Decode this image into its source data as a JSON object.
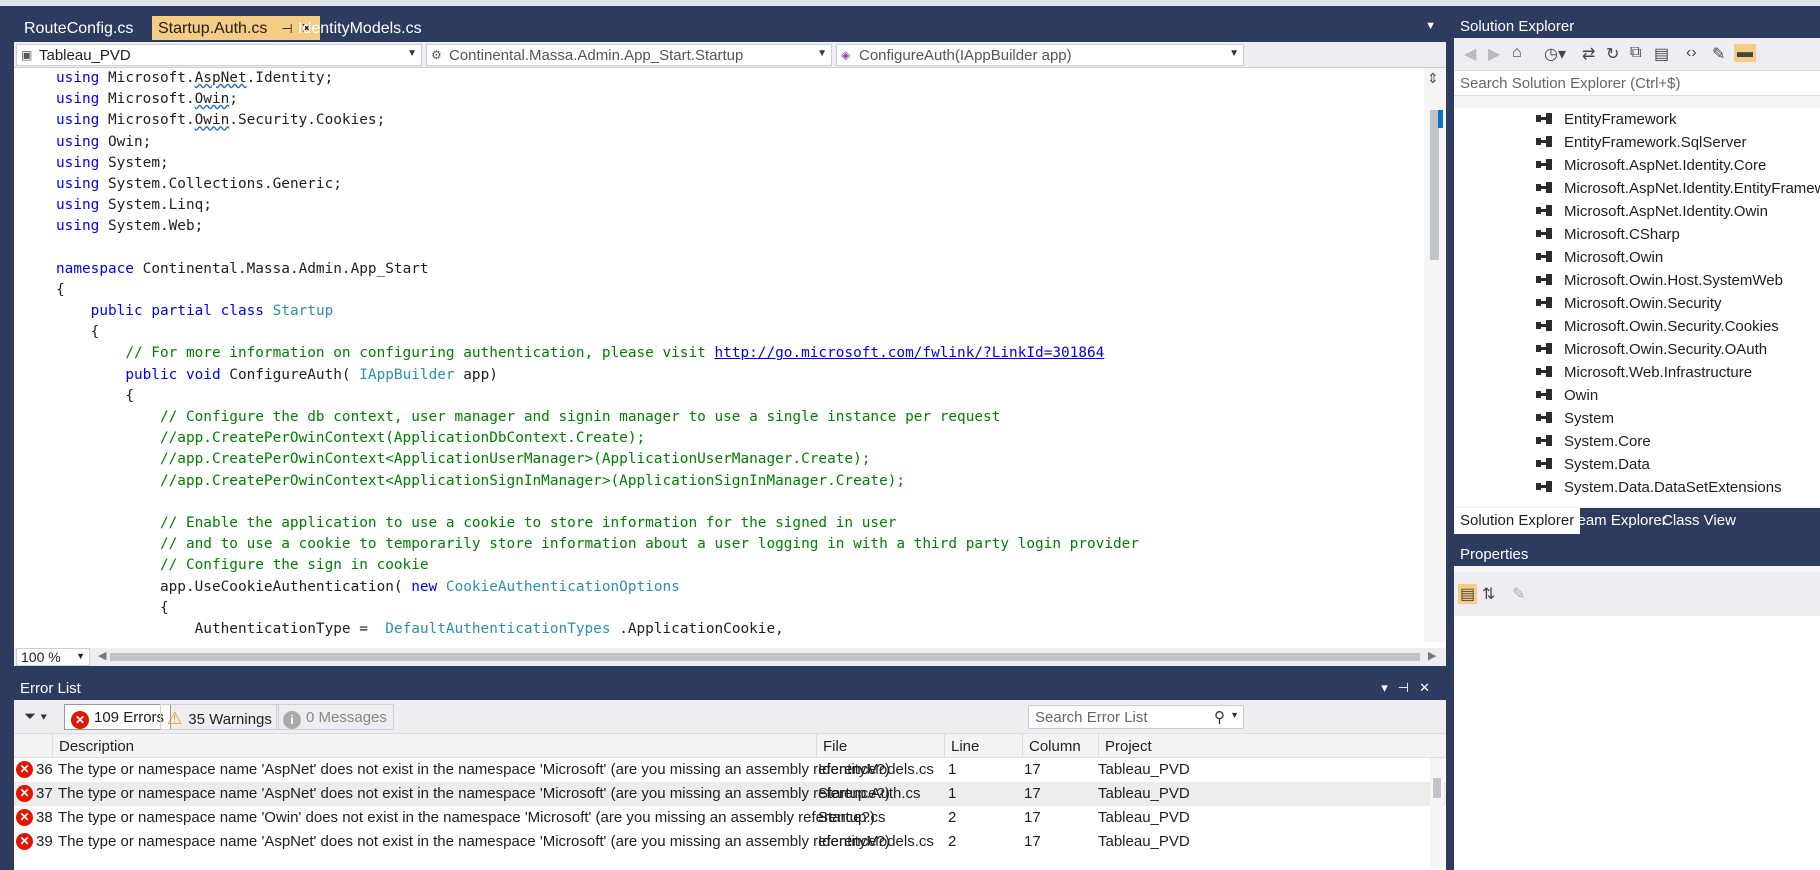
{
  "tabs": [
    {
      "label": "RouteConfig.cs",
      "active": false
    },
    {
      "label": "Startup.Auth.cs",
      "active": true
    },
    {
      "label": "IdentityModels.cs",
      "active": false
    }
  ],
  "navbar": {
    "project": "Tableau_PVD",
    "type": "Continental.Massa.Admin.App_Start.Startup",
    "member": "ConfigureAuth(IAppBuilder app)"
  },
  "code_lines": [
    {
      "indent": "",
      "parts": [
        [
          "kw",
          "using"
        ],
        [
          "",
          "Microsoft.AspNet.Identity;"
        ]
      ]
    },
    {
      "indent": "",
      "parts": [
        [
          "kw",
          "using"
        ],
        [
          "",
          "Microsoft.Owin;"
        ]
      ]
    },
    {
      "indent": "",
      "parts": [
        [
          "kw",
          "using"
        ],
        [
          "",
          "Microsoft.Owin.Security.Cookies;"
        ]
      ]
    },
    {
      "indent": "",
      "parts": [
        [
          "kw",
          "using"
        ],
        [
          "",
          "Owin;"
        ]
      ]
    },
    {
      "indent": "",
      "parts": [
        [
          "kw",
          "using"
        ],
        [
          "",
          "System;"
        ]
      ]
    },
    {
      "indent": "",
      "parts": [
        [
          "kw",
          "using"
        ],
        [
          "",
          "System.Collections.Generic;"
        ]
      ]
    },
    {
      "indent": "",
      "parts": [
        [
          "kw",
          "using"
        ],
        [
          "",
          "System.Linq;"
        ]
      ]
    },
    {
      "indent": "",
      "parts": [
        [
          "kw",
          "using"
        ],
        [
          "",
          "System.Web;"
        ]
      ]
    },
    {
      "indent": "",
      "parts": []
    },
    {
      "indent": "",
      "parts": [
        [
          "kw",
          "namespace"
        ],
        [
          "",
          "Continental.Massa.Admin.App_Start"
        ]
      ]
    },
    {
      "indent": "",
      "parts": [
        [
          "",
          "{"
        ]
      ]
    },
    {
      "indent": "    ",
      "parts": [
        [
          "kw",
          "public"
        ],
        [
          "kw",
          "partial"
        ],
        [
          "kw",
          "class"
        ],
        [
          "ty",
          "Startup"
        ]
      ]
    },
    {
      "indent": "    ",
      "parts": [
        [
          "",
          "{"
        ]
      ]
    },
    {
      "indent": "        ",
      "parts": [
        [
          "cm",
          "// For more information on configuring authentication, please visit"
        ],
        [
          "lk",
          "http://go.microsoft.com/fwlink/?LinkId=301864"
        ]
      ]
    },
    {
      "indent": "        ",
      "parts": [
        [
          "kw",
          "public"
        ],
        [
          "kw",
          "void"
        ],
        [
          "",
          "ConfigureAuth("
        ],
        [
          "ty",
          "IAppBuilder"
        ],
        [
          "",
          "app)"
        ]
      ]
    },
    {
      "indent": "        ",
      "parts": [
        [
          "",
          "{"
        ]
      ]
    },
    {
      "indent": "            ",
      "parts": [
        [
          "cm",
          "// Configure the db context, user manager and signin manager to use a single instance per request"
        ]
      ]
    },
    {
      "indent": "            ",
      "parts": [
        [
          "cm",
          "//app.CreatePerOwinContext(ApplicationDbContext.Create);"
        ]
      ]
    },
    {
      "indent": "            ",
      "parts": [
        [
          "cm",
          "//app.CreatePerOwinContext<ApplicationUserManager>(ApplicationUserManager.Create);"
        ]
      ]
    },
    {
      "indent": "            ",
      "parts": [
        [
          "cm",
          "//app.CreatePerOwinContext<ApplicationSignInManager>(ApplicationSignInManager.Create);"
        ]
      ]
    },
    {
      "indent": "",
      "parts": []
    },
    {
      "indent": "            ",
      "parts": [
        [
          "cm",
          "// Enable the application to use a cookie to store information for the signed in user"
        ]
      ]
    },
    {
      "indent": "            ",
      "parts": [
        [
          "cm",
          "// and to use a cookie to temporarily store information about a user logging in with a third party login provider"
        ]
      ]
    },
    {
      "indent": "            ",
      "parts": [
        [
          "cm",
          "// Configure the sign in cookie"
        ]
      ]
    },
    {
      "indent": "            ",
      "parts": [
        [
          "",
          "app.UseCookieAuthentication("
        ],
        [
          "kw",
          "new"
        ],
        [
          "ty",
          "CookieAuthenticationOptions"
        ]
      ]
    },
    {
      "indent": "            ",
      "parts": [
        [
          "",
          "{"
        ]
      ]
    },
    {
      "indent": "                ",
      "parts": [
        [
          "",
          "AuthenticationType = "
        ],
        [
          "ty",
          "DefaultAuthenticationTypes"
        ],
        [
          "",
          ".ApplicationCookie,"
        ]
      ]
    }
  ],
  "zoom": "100 %",
  "error_list": {
    "title": "Error List",
    "errors_label": "109 Errors",
    "warnings_label": "35 Warnings",
    "messages_label": "0 Messages",
    "search_placeholder": "Search Error List",
    "columns": [
      "Description",
      "File",
      "Line",
      "Column",
      "Project"
    ],
    "rows": [
      {
        "num": "36",
        "description": "The type or namespace name 'AspNet' does not exist in the namespace 'Microsoft' (are you missing an assembly reference?)",
        "file": "IdentityModels.cs",
        "line": "1",
        "column": "17",
        "project": "Tableau_PVD"
      },
      {
        "num": "37",
        "description": "The type or namespace name 'AspNet' does not exist in the namespace 'Microsoft' (are you missing an assembly reference?)",
        "file": "Startup.Auth.cs",
        "line": "1",
        "column": "17",
        "project": "Tableau_PVD"
      },
      {
        "num": "38",
        "description": "The type or namespace name 'Owin' does not exist in the namespace 'Microsoft' (are you missing an assembly reference?)",
        "file": "Startup.cs",
        "line": "2",
        "column": "17",
        "project": "Tableau_PVD"
      },
      {
        "num": "39",
        "description": "The type or namespace name 'AspNet' does not exist in the namespace 'Microsoft' (are you missing an assembly reference?)",
        "file": "IdentityModels.cs",
        "line": "2",
        "column": "17",
        "project": "Tableau_PVD"
      }
    ]
  },
  "solution_explorer": {
    "title": "Solution Explorer",
    "search_placeholder": "Search Solution Explorer (Ctrl+$)",
    "references": [
      "EntityFramework",
      "EntityFramework.SqlServer",
      "Microsoft.AspNet.Identity.Core",
      "Microsoft.AspNet.Identity.EntityFramework",
      "Microsoft.AspNet.Identity.Owin",
      "Microsoft.CSharp",
      "Microsoft.Owin",
      "Microsoft.Owin.Host.SystemWeb",
      "Microsoft.Owin.Security",
      "Microsoft.Owin.Security.Cookies",
      "Microsoft.Owin.Security.OAuth",
      "Microsoft.Web.Infrastructure",
      "Owin",
      "System",
      "System.Core",
      "System.Data",
      "System.Data.DataSetExtensions"
    ],
    "tabs": [
      "Solution Explorer",
      "Team Explorer",
      "Class View"
    ]
  },
  "properties": {
    "title": "Properties"
  },
  "colors": {
    "chrome": "#2d3b5e",
    "active_tab": "#f5cc84",
    "keyword": "#0000ff",
    "type": "#2b91af",
    "comment": "#008000",
    "error": "#e51400"
  }
}
